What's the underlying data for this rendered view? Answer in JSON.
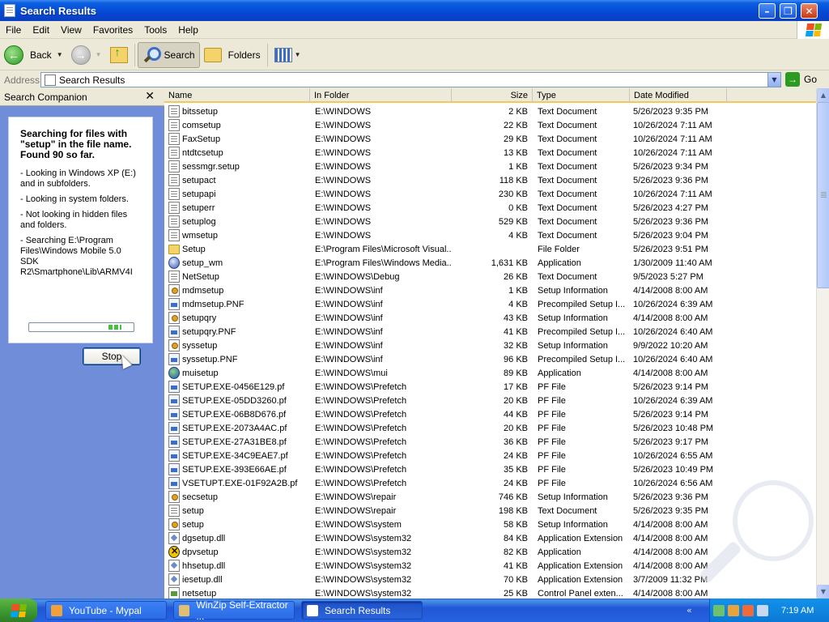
{
  "window": {
    "title": "Search Results"
  },
  "menu": [
    "File",
    "Edit",
    "View",
    "Favorites",
    "Tools",
    "Help"
  ],
  "toolbar": {
    "back": "Back",
    "search": "Search",
    "folders": "Folders"
  },
  "address": {
    "label": "Address",
    "value": "Search Results",
    "go": "Go"
  },
  "search_companion": {
    "header": "Search Companion",
    "title": "Searching for files with \"setup\" in the file name. Found 90 so far.",
    "lines": [
      "- Looking in Windows XP (E:) and in subfolders.",
      "- Looking in system folders.",
      "- Not looking in hidden files and folders.",
      "- Searching E:\\Program Files\\Windows Mobile 5.0 SDK R2\\Smartphone\\Lib\\ARMV4I"
    ],
    "stop": "Stop"
  },
  "columns": {
    "name": "Name",
    "folder": "In Folder",
    "size": "Size",
    "type": "Type",
    "modified": "Date Modified"
  },
  "files": [
    {
      "name": "bitssetup",
      "folder": "E:\\WINDOWS",
      "size": "2 KB",
      "type": "Text Document",
      "modified": "5/26/2023 9:35 PM",
      "icon": "doc"
    },
    {
      "name": "comsetup",
      "folder": "E:\\WINDOWS",
      "size": "22 KB",
      "type": "Text Document",
      "modified": "10/26/2024 7:11 AM",
      "icon": "doc"
    },
    {
      "name": "FaxSetup",
      "folder": "E:\\WINDOWS",
      "size": "29 KB",
      "type": "Text Document",
      "modified": "10/26/2024 7:11 AM",
      "icon": "doc"
    },
    {
      "name": "ntdtcsetup",
      "folder": "E:\\WINDOWS",
      "size": "13 KB",
      "type": "Text Document",
      "modified": "10/26/2024 7:11 AM",
      "icon": "doc"
    },
    {
      "name": "sessmgr.setup",
      "folder": "E:\\WINDOWS",
      "size": "1 KB",
      "type": "Text Document",
      "modified": "5/26/2023 9:34 PM",
      "icon": "doc"
    },
    {
      "name": "setupact",
      "folder": "E:\\WINDOWS",
      "size": "118 KB",
      "type": "Text Document",
      "modified": "5/26/2023 9:36 PM",
      "icon": "doc"
    },
    {
      "name": "setupapi",
      "folder": "E:\\WINDOWS",
      "size": "230 KB",
      "type": "Text Document",
      "modified": "10/26/2024 7:11 AM",
      "icon": "doc"
    },
    {
      "name": "setuperr",
      "folder": "E:\\WINDOWS",
      "size": "0 KB",
      "type": "Text Document",
      "modified": "5/26/2023 4:27 PM",
      "icon": "doc"
    },
    {
      "name": "setuplog",
      "folder": "E:\\WINDOWS",
      "size": "529 KB",
      "type": "Text Document",
      "modified": "5/26/2023 9:36 PM",
      "icon": "doc"
    },
    {
      "name": "wmsetup",
      "folder": "E:\\WINDOWS",
      "size": "4 KB",
      "type": "Text Document",
      "modified": "5/26/2023 9:04 PM",
      "icon": "doc"
    },
    {
      "name": "Setup",
      "folder": "E:\\Program Files\\Microsoft Visual...",
      "size": "",
      "type": "File Folder",
      "modified": "5/26/2023 9:51 PM",
      "icon": "folder"
    },
    {
      "name": "setup_wm",
      "folder": "E:\\Program Files\\Windows Media...",
      "size": "1,631 KB",
      "type": "Application",
      "modified": "1/30/2009 11:40 AM",
      "icon": "app"
    },
    {
      "name": "NetSetup",
      "folder": "E:\\WINDOWS\\Debug",
      "size": "26 KB",
      "type": "Text Document",
      "modified": "9/5/2023 5:27 PM",
      "icon": "doc"
    },
    {
      "name": "mdmsetup",
      "folder": "E:\\WINDOWS\\inf",
      "size": "1 KB",
      "type": "Setup Information",
      "modified": "4/14/2008 8:00 AM",
      "icon": "cfg"
    },
    {
      "name": "mdmsetup.PNF",
      "folder": "E:\\WINDOWS\\inf",
      "size": "4 KB",
      "type": "Precompiled Setup I...",
      "modified": "10/26/2024 6:39 AM",
      "icon": "pf"
    },
    {
      "name": "setupqry",
      "folder": "E:\\WINDOWS\\inf",
      "size": "43 KB",
      "type": "Setup Information",
      "modified": "4/14/2008 8:00 AM",
      "icon": "cfg"
    },
    {
      "name": "setupqry.PNF",
      "folder": "E:\\WINDOWS\\inf",
      "size": "41 KB",
      "type": "Precompiled Setup I...",
      "modified": "10/26/2024 6:40 AM",
      "icon": "pf"
    },
    {
      "name": "syssetup",
      "folder": "E:\\WINDOWS\\inf",
      "size": "32 KB",
      "type": "Setup Information",
      "modified": "9/9/2022 10:20 AM",
      "icon": "cfg"
    },
    {
      "name": "syssetup.PNF",
      "folder": "E:\\WINDOWS\\inf",
      "size": "96 KB",
      "type": "Precompiled Setup I...",
      "modified": "10/26/2024 6:40 AM",
      "icon": "pf"
    },
    {
      "name": "muisetup",
      "folder": "E:\\WINDOWS\\mui",
      "size": "89 KB",
      "type": "Application",
      "modified": "4/14/2008 8:00 AM",
      "icon": "globe"
    },
    {
      "name": "SETUP.EXE-0456E129.pf",
      "folder": "E:\\WINDOWS\\Prefetch",
      "size": "17 KB",
      "type": "PF File",
      "modified": "5/26/2023 9:14 PM",
      "icon": "pf"
    },
    {
      "name": "SETUP.EXE-05DD3260.pf",
      "folder": "E:\\WINDOWS\\Prefetch",
      "size": "20 KB",
      "type": "PF File",
      "modified": "10/26/2024 6:39 AM",
      "icon": "pf"
    },
    {
      "name": "SETUP.EXE-06B8D676.pf",
      "folder": "E:\\WINDOWS\\Prefetch",
      "size": "44 KB",
      "type": "PF File",
      "modified": "5/26/2023 9:14 PM",
      "icon": "pf"
    },
    {
      "name": "SETUP.EXE-2073A4AC.pf",
      "folder": "E:\\WINDOWS\\Prefetch",
      "size": "20 KB",
      "type": "PF File",
      "modified": "5/26/2023 10:48 PM",
      "icon": "pf"
    },
    {
      "name": "SETUP.EXE-27A31BE8.pf",
      "folder": "E:\\WINDOWS\\Prefetch",
      "size": "36 KB",
      "type": "PF File",
      "modified": "5/26/2023 9:17 PM",
      "icon": "pf"
    },
    {
      "name": "SETUP.EXE-34C9EAE7.pf",
      "folder": "E:\\WINDOWS\\Prefetch",
      "size": "24 KB",
      "type": "PF File",
      "modified": "10/26/2024 6:55 AM",
      "icon": "pf"
    },
    {
      "name": "SETUP.EXE-393E66AE.pf",
      "folder": "E:\\WINDOWS\\Prefetch",
      "size": "35 KB",
      "type": "PF File",
      "modified": "5/26/2023 10:49 PM",
      "icon": "pf"
    },
    {
      "name": "VSETUPT.EXE-01F92A2B.pf",
      "folder": "E:\\WINDOWS\\Prefetch",
      "size": "24 KB",
      "type": "PF File",
      "modified": "10/26/2024 6:56 AM",
      "icon": "pf"
    },
    {
      "name": "secsetup",
      "folder": "E:\\WINDOWS\\repair",
      "size": "746 KB",
      "type": "Setup Information",
      "modified": "5/26/2023 9:36 PM",
      "icon": "cfg"
    },
    {
      "name": "setup",
      "folder": "E:\\WINDOWS\\repair",
      "size": "198 KB",
      "type": "Text Document",
      "modified": "5/26/2023 9:35 PM",
      "icon": "doc"
    },
    {
      "name": "setup",
      "folder": "E:\\WINDOWS\\system",
      "size": "58 KB",
      "type": "Setup Information",
      "modified": "4/14/2008 8:00 AM",
      "icon": "cfg"
    },
    {
      "name": "dgsetup.dll",
      "folder": "E:\\WINDOWS\\system32",
      "size": "84 KB",
      "type": "Application Extension",
      "modified": "4/14/2008 8:00 AM",
      "icon": "dll"
    },
    {
      "name": "dpvsetup",
      "folder": "E:\\WINDOWS\\system32",
      "size": "82 KB",
      "type": "Application",
      "modified": "4/14/2008 8:00 AM",
      "icon": "xapp"
    },
    {
      "name": "hhsetup.dll",
      "folder": "E:\\WINDOWS\\system32",
      "size": "41 KB",
      "type": "Application Extension",
      "modified": "4/14/2008 8:00 AM",
      "icon": "dll"
    },
    {
      "name": "iesetup.dll",
      "folder": "E:\\WINDOWS\\system32",
      "size": "70 KB",
      "type": "Application Extension",
      "modified": "3/7/2009 11:32 PM",
      "icon": "dll"
    },
    {
      "name": "netsetup",
      "folder": "E:\\WINDOWS\\system32",
      "size": "25 KB",
      "type": "Control Panel exten...",
      "modified": "4/14/2008 8:00 AM",
      "icon": "cpl"
    }
  ],
  "taskbar": {
    "tasks": [
      "YouTube - Mypal",
      "WinZip Self-Extractor ...",
      "Search Results"
    ],
    "clock": "7:19 AM"
  },
  "colors": {
    "titlebar": "#0548d3",
    "pane_bg": "#6f8dd8",
    "taskbar": "#2157d7"
  }
}
